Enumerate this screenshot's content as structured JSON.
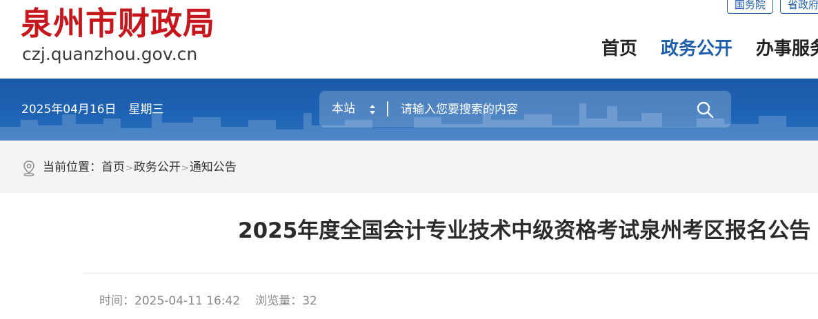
{
  "header": {
    "logo_title": "泉州市财政局",
    "logo_url": "czj.quanzhou.gov.cn",
    "top_links": [
      "国务院",
      "省政府"
    ],
    "nav": [
      "首页",
      "政务公开",
      "办事服务"
    ],
    "nav_active": "政务公开"
  },
  "band": {
    "date": "2025年04月16日",
    "weekday": "星期三"
  },
  "search": {
    "scope": "本站",
    "placeholder": "请输入您要搜索的内容"
  },
  "breadcrumb": {
    "label": "当前位置：",
    "items": [
      "首页",
      "政务公开",
      "通知公告"
    ],
    "separator": ">"
  },
  "article": {
    "title": "2025年度全国会计专业技术中级资格考试泉州考区报名公告",
    "time_label": "时间：",
    "time_value": "2025-04-11 16:42",
    "views_label": "浏览量：",
    "views_value": "32"
  },
  "colors": {
    "brand_red": "#c8161d",
    "brand_blue": "#1d5fae"
  },
  "icons": [
    "location-pin-icon",
    "search-icon",
    "sort-arrows-icon"
  ]
}
